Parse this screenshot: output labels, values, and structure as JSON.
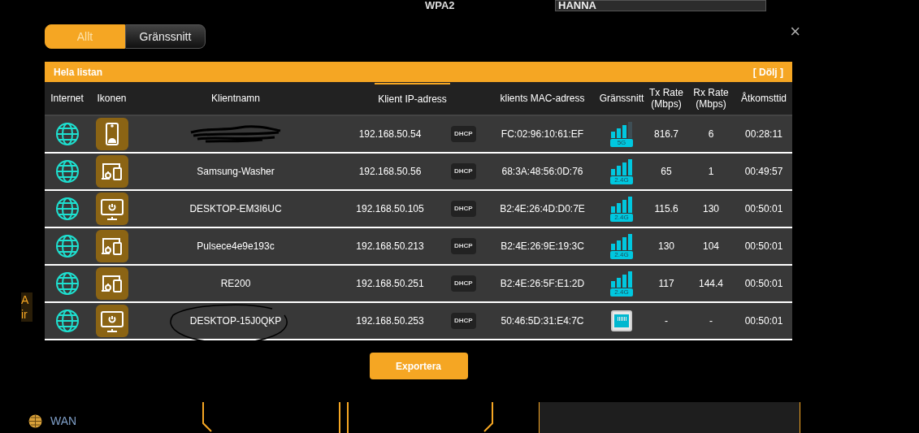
{
  "background": {
    "top_label": "WPA2",
    "network_name": "HANNA",
    "sidebar_fragment": [
      "A",
      "ir"
    ],
    "wan_label": "WAN"
  },
  "tabs": [
    {
      "label": "Allt",
      "selected": true
    },
    {
      "label": "Gränssnitt",
      "selected": false
    }
  ],
  "close_symbol": "×",
  "list_bar": {
    "title": "Hela listan",
    "toggle": "[ Dölj ]"
  },
  "table": {
    "columns": [
      {
        "label": "Internet",
        "sorted": false
      },
      {
        "label": "Ikonen",
        "sorted": false
      },
      {
        "label": "Klientnamn",
        "sorted": false
      },
      {
        "label": "Klient IP-adress",
        "sorted": true
      },
      {
        "label": "klients MAC-adress",
        "sorted": false
      },
      {
        "label": "Gränssnitt",
        "sorted": false
      },
      {
        "label": "Tx Rate (Mbps)",
        "sorted": false
      },
      {
        "label": "Rx Rate (Mbps)",
        "sorted": false
      },
      {
        "label": "Åtkomsttid",
        "sorted": false
      }
    ],
    "rows": [
      {
        "kind": "phone",
        "name_redacted": true,
        "circled": false,
        "ip": "192.168.50.54",
        "ip_badge": "DHCP",
        "mac": "FC:02:96:10:61:EF",
        "interface": {
          "kind": "wifi",
          "band": "5G",
          "full_signal": false
        },
        "tx": "816.7",
        "rx": "6",
        "time": "00:28:11"
      },
      {
        "kind": "iot",
        "name": "Samsung-Washer",
        "name_redacted": false,
        "circled": false,
        "ip": "192.168.50.56",
        "ip_badge": "DHCP",
        "mac": "68:3A:48:56:0D:76",
        "interface": {
          "kind": "wifi",
          "band": "2.4G",
          "full_signal": true
        },
        "tx": "65",
        "rx": "1",
        "time": "00:49:57"
      },
      {
        "kind": "desktop",
        "name": "DESKTOP-EM3I6UC",
        "name_redacted": false,
        "circled": false,
        "ip": "192.168.50.105",
        "ip_badge": "DHCP",
        "mac": "B2:4E:26:4D:D0:7E",
        "interface": {
          "kind": "wifi",
          "band": "2.4G",
          "full_signal": true
        },
        "tx": "115.6",
        "rx": "130",
        "time": "00:50:01"
      },
      {
        "kind": "iot",
        "name": "Pulsece4e9e193c",
        "name_redacted": false,
        "circled": false,
        "ip": "192.168.50.213",
        "ip_badge": "DHCP",
        "mac": "B2:4E:26:9E:19:3C",
        "interface": {
          "kind": "wifi",
          "band": "2.4G",
          "full_signal": true
        },
        "tx": "130",
        "rx": "104",
        "time": "00:50:01"
      },
      {
        "kind": "iot",
        "name": "RE200",
        "name_redacted": false,
        "circled": false,
        "ip": "192.168.50.251",
        "ip_badge": "DHCP",
        "mac": "B2:4E:26:5F:E1:2D",
        "interface": {
          "kind": "wifi",
          "band": "2.4G",
          "full_signal": true
        },
        "tx": "117",
        "rx": "144.4",
        "time": "00:50:01"
      },
      {
        "kind": "desktop",
        "name": "DESKTOP-15J0QKP",
        "name_redacted": false,
        "circled": true,
        "ip": "192.168.50.253",
        "ip_badge": "DHCP",
        "mac": "50:46:5D:31:E4:7C",
        "interface": {
          "kind": "wired"
        },
        "tx": "-",
        "rx": "-",
        "time": "00:50:01"
      }
    ]
  },
  "export_button": "Exportera"
}
